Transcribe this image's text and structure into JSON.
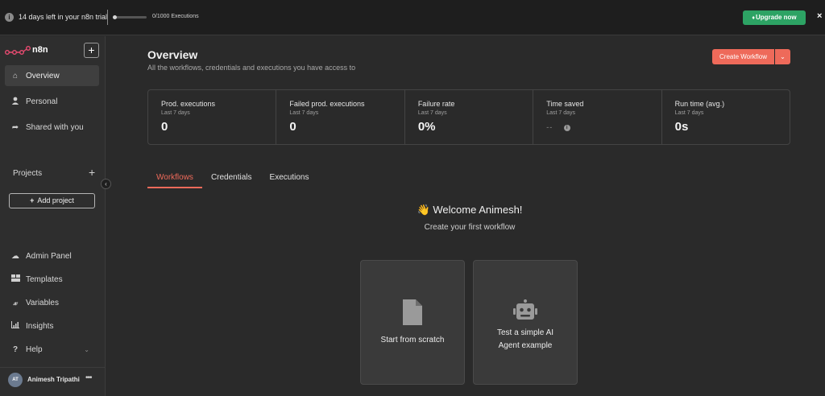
{
  "trial": {
    "text": "14 days left in your n8n trial",
    "executions": "0/1000 Executions",
    "progress": 0,
    "upgrade_label": "Upgrade now"
  },
  "sidebar": {
    "brand": "n8n",
    "nav": [
      {
        "label": "Overview",
        "icon": "home-icon",
        "active": true
      },
      {
        "label": "Personal",
        "icon": "user-icon",
        "active": false
      },
      {
        "label": "Shared with you",
        "icon": "share-icon",
        "active": false
      }
    ],
    "projects_label": "Projects",
    "add_project_label": "Add project",
    "bottom": [
      {
        "label": "Admin Panel",
        "icon": "cloud-icon"
      },
      {
        "label": "Templates",
        "icon": "templates-icon"
      },
      {
        "label": "Variables",
        "icon": "variables-icon"
      },
      {
        "label": "Insights",
        "icon": "insights-icon"
      },
      {
        "label": "Help",
        "icon": "help-icon"
      }
    ],
    "user": {
      "initials": "AT",
      "name": "Animesh Tripathi"
    }
  },
  "main": {
    "title": "Overview",
    "subtitle": "All the workflows, credentials and executions you have access to",
    "create_label": "Create Workflow",
    "stats": [
      {
        "label": "Prod. executions",
        "period": "Last 7 days",
        "value": "0"
      },
      {
        "label": "Failed prod. executions",
        "period": "Last 7 days",
        "value": "0"
      },
      {
        "label": "Failure rate",
        "period": "Last 7 days",
        "value": "0%"
      },
      {
        "label": "Time saved",
        "period": "Last 7 days",
        "value": "--"
      },
      {
        "label": "Run time (avg.)",
        "period": "Last 7 days",
        "value": "0s"
      }
    ],
    "tabs": [
      "Workflows",
      "Credentials",
      "Executions"
    ],
    "active_tab": "Workflows",
    "welcome": "Welcome Animesh!",
    "welcome_emoji": "👋",
    "welcome_sub": "Create your first workflow",
    "cards": [
      {
        "label": "Start from scratch",
        "icon": "file-icon"
      },
      {
        "label_line1": "Test a simple AI",
        "label_line2": "Agent example",
        "icon": "robot-icon"
      }
    ]
  },
  "colors": {
    "accent": "#ee6a5a",
    "upgrade": "#2da364",
    "background": "#2a2a2a"
  }
}
